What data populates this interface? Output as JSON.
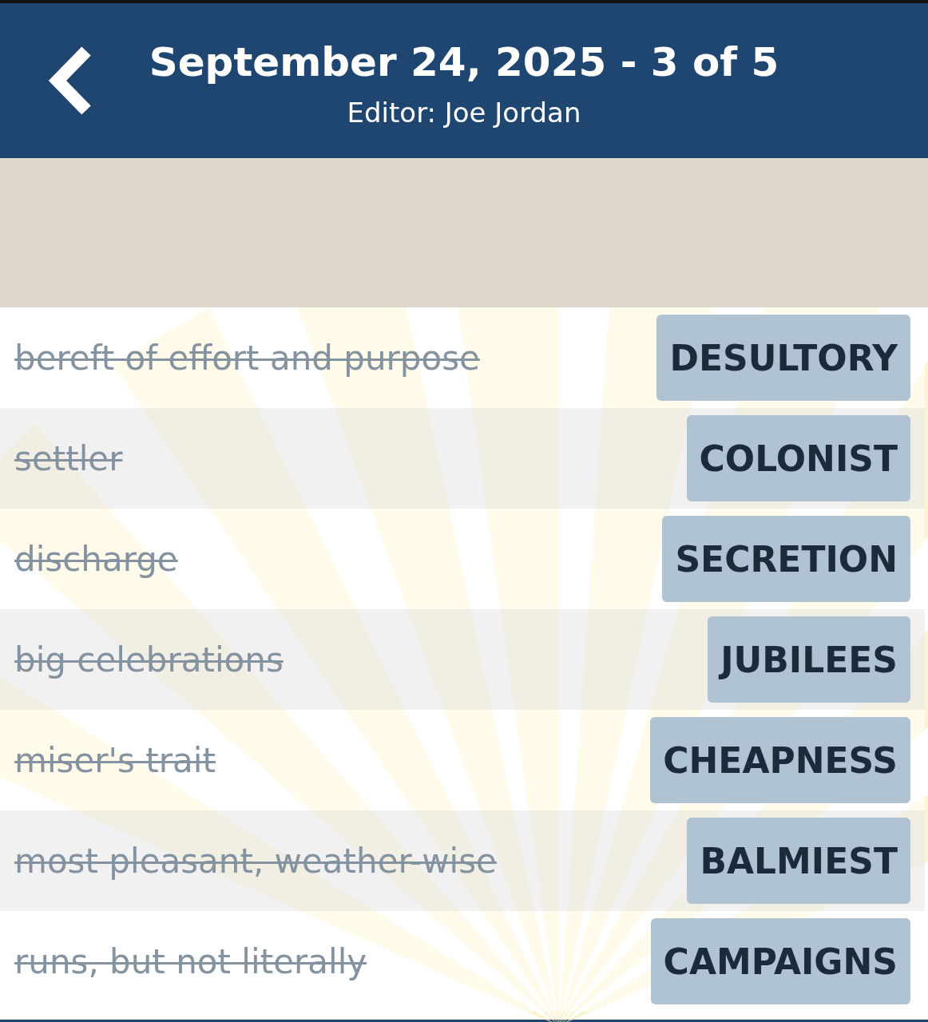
{
  "header": {
    "title": "September 24, 2025 - 3 of 5",
    "subtitle": "Editor: Joe Jordan"
  },
  "clues": [
    {
      "clue": "bereft of effort and purpose",
      "answer": "DESULTORY",
      "solved": true
    },
    {
      "clue": "settler",
      "answer": "COLONIST",
      "solved": true
    },
    {
      "clue": "discharge",
      "answer": "SECRETION",
      "solved": true
    },
    {
      "clue": "big celebrations",
      "answer": "JUBILEES",
      "solved": true
    },
    {
      "clue": "miser's trait",
      "answer": "CHEAPNESS",
      "solved": true
    },
    {
      "clue": "most pleasant, weather-wise",
      "answer": "BALMIEST",
      "solved": true
    },
    {
      "clue": "runs, but not literally",
      "answer": "CAMPAIGNS",
      "solved": true
    }
  ]
}
